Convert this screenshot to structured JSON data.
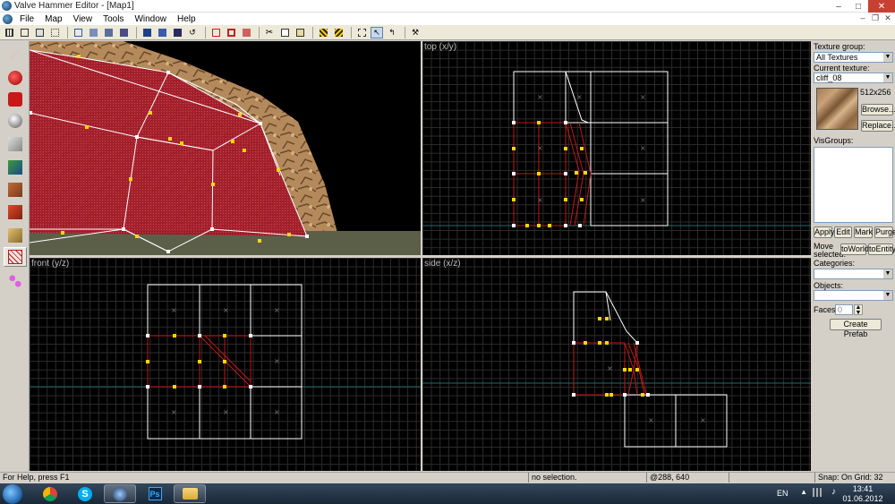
{
  "window": {
    "title": "Valve Hammer Editor - [Map1]",
    "minimize": "–",
    "maximize": "□",
    "close": "✕"
  },
  "menu": [
    "File",
    "Map",
    "View",
    "Tools",
    "Window",
    "Help"
  ],
  "viewports": {
    "camera_label": "",
    "top_label": "top (x/y)",
    "front_label": "front (y/z)",
    "side_label": "side (x/z)"
  },
  "panel": {
    "texture_group_label": "Texture group:",
    "texture_group_value": "All Textures",
    "current_texture_label": "Current texture:",
    "current_texture_value": "cliff_08",
    "texture_size": "512x256",
    "browse_label": "Browse...",
    "replace_label": "Replace...",
    "visgroups_label": "VisGroups:",
    "apply_label": "Apply",
    "edit_label": "Edit",
    "mark_label": "Mark",
    "purge_label": "Purge",
    "move_selected_label_1": "Move",
    "move_selected_label_2": "selected:",
    "to_world_label": "toWorld",
    "to_entity_label": "toEntity",
    "categories_label": "Categories:",
    "objects_label": "Objects:",
    "faces_label": "Faces:",
    "faces_value": "0",
    "create_prefab_label": "Create Prefab"
  },
  "status": {
    "help": "For Help, press F1",
    "selection": "no selection.",
    "coords": "@288, 640",
    "snap": "Snap: On Grid: 32"
  },
  "tray": {
    "lang": "EN",
    "time": "13:41",
    "date": "01.06.2012"
  },
  "colors": {
    "brush_red": "#b01020",
    "vertex_yellow": "#ffd700",
    "wire_white": "#ffffff",
    "grid_dark": "#2d2d2d",
    "axis_teal": "#1d6b6b"
  }
}
